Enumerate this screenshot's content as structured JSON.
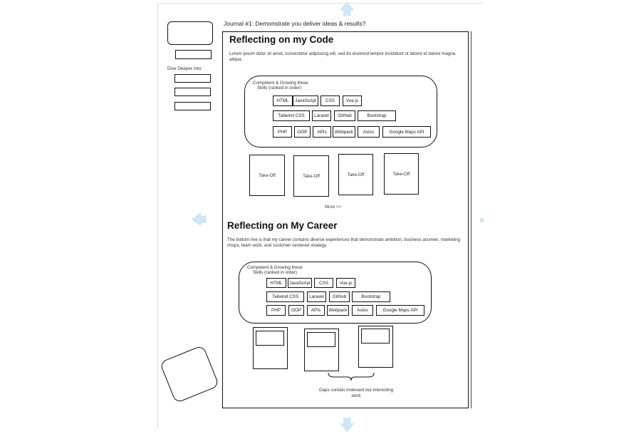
{
  "journal": {
    "title": "Journal #1: Demonstrate you deliver ideas & results?"
  },
  "sidebar": {
    "dive_deeper_label": "Dive Deeper Into:"
  },
  "code_section": {
    "heading": "Reflecting on my Code",
    "body": "Lorem ipsum dolor sit amet, consectetur adipiscing elit, sed do eiusmod tempor incididunt ut labore et dolore magna aliqua.",
    "skills_caption_line1": "Competent & Growing these",
    "skills_caption_line2": "Skills (ranked in order)",
    "skills": [
      [
        "HTML",
        "JavaScript",
        "CSS",
        "Vue.js"
      ],
      [
        "Tailwind CSS",
        "Laravel",
        "GitHub",
        "Bootstrap"
      ],
      [
        "PHP",
        "OOP",
        "APIs",
        "Webpack",
        "Axios",
        "Google Maps API"
      ]
    ],
    "cards": [
      "Take-Off",
      "Take-Off",
      "Take-Off",
      "Take-Off"
    ],
    "more_link": "More >>"
  },
  "career_section": {
    "heading": "Reflecting on My Career",
    "body": "The bottom line is that my career contains diverse experiences that demonstrate ambition, business acumen, marketing chops, team work, and customer centered strategy.",
    "skills_caption_line1": "Competent & Growing these",
    "skills_caption_line2": "Skills (ranked in order)",
    "skills": [
      [
        "HTML",
        "JavaScript",
        "CSS",
        "Vue.js"
      ],
      [
        "Tailwind CSS",
        "Laravel",
        "GitHub",
        "Bootstrap"
      ],
      [
        "PHP",
        "OOP",
        "APIs",
        "Webpack",
        "Axios",
        "Google Maps API"
      ]
    ],
    "gaps_note": "Gaps contain irrelevant but interesting work"
  },
  "colors": {
    "hint_arrow": "#cfe6f5",
    "stroke": "#111111"
  }
}
